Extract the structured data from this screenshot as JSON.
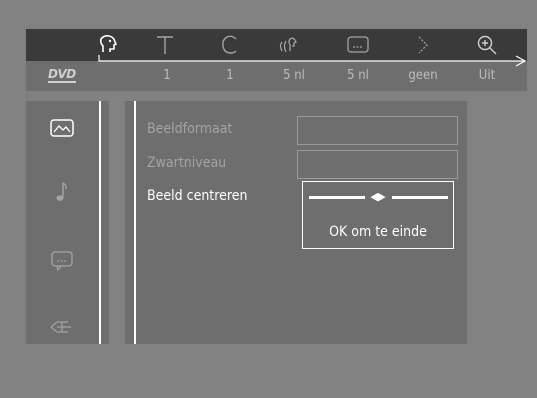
{
  "header": {
    "logo": "DVD",
    "icons": [
      {
        "name": "angle-icon",
        "value": ""
      },
      {
        "name": "title-icon",
        "value": "1"
      },
      {
        "name": "chapter-icon",
        "value": "1"
      },
      {
        "name": "audio-icon",
        "value": "5 nl"
      },
      {
        "name": "subtitle-icon",
        "value": "5 nl"
      },
      {
        "name": "slow-motion-icon",
        "value": "geen"
      },
      {
        "name": "zoom-icon",
        "value": "Uit"
      }
    ]
  },
  "sidebar": {
    "items": [
      {
        "name": "picture-icon",
        "active": true
      },
      {
        "name": "sound-icon",
        "active": false
      },
      {
        "name": "language-icon",
        "active": false
      },
      {
        "name": "features-icon",
        "active": false
      }
    ]
  },
  "menu": {
    "rows": [
      {
        "label": "Beeldformaat",
        "active": false
      },
      {
        "label": "Zwartniveau",
        "active": false
      },
      {
        "label": "Beeld centreren",
        "active": true
      }
    ]
  },
  "popup": {
    "arrows": "◀▶",
    "hint": "OK om te einde"
  },
  "colors": {
    "background": "#818181",
    "panel": "#6e6e6e",
    "topbar": "#3a3a3a",
    "active_text": "#ffffff",
    "inactive_text": "#a3a3a3"
  }
}
